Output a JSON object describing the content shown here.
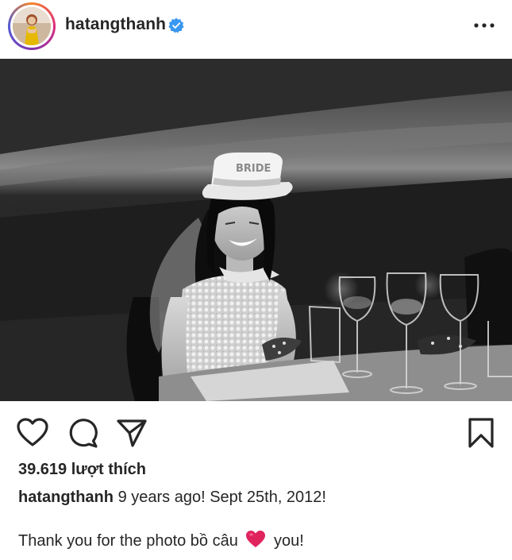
{
  "post": {
    "username": "hatangthanh",
    "verified": true,
    "likes_text": "39.619 lượt thích",
    "caption_author": "hatangthanh",
    "caption_text": "9 years ago! Sept 25th, 2012!",
    "comment_before_emoji": "Thank you for the photo bồ câu",
    "comment_emoji": "red-heart",
    "comment_after_emoji": "you!",
    "photo_hat_text": "BRIDE"
  },
  "icons": {
    "like": "heart-icon",
    "comment": "comment-bubble-icon",
    "share": "paper-plane-icon",
    "save": "bookmark-icon",
    "more": "more-options-icon",
    "verified": "verified-badge-icon"
  },
  "colors": {
    "verified_blue": "#3897f0",
    "emoji_red": "#e0245e",
    "text": "#262626"
  }
}
